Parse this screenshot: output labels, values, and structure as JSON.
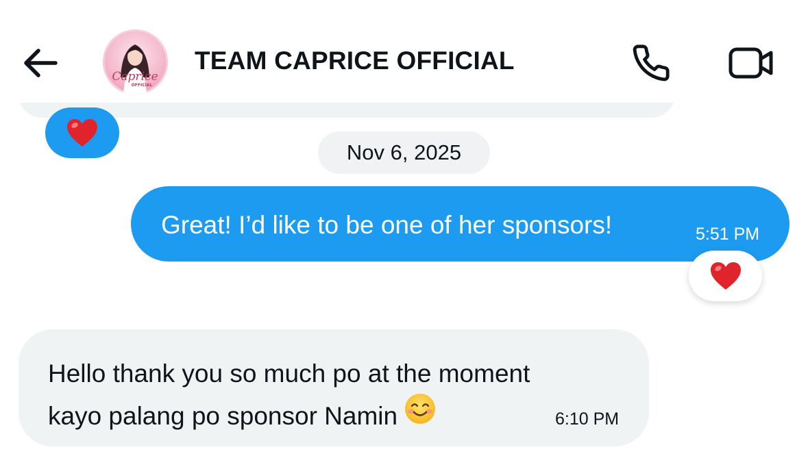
{
  "header": {
    "title": "TEAM CAPRICE OFFICIAL",
    "back_icon": "arrow-left-icon",
    "call_icon": "phone-icon",
    "video_icon": "video-camera-icon",
    "avatar_text": "Caprice",
    "avatar_subtext": "OFFICIAL"
  },
  "colors": {
    "accent": "#1d9bf0",
    "bubble_received": "#eff3f4",
    "text": "#0f1419",
    "heart": "#e0242c"
  },
  "conversation": {
    "date_separator": "Nov 6, 2025",
    "messages": [
      {
        "direction": "sent",
        "text": "Great! I’d like to be one of her sponsors!",
        "time": "5:51 PM",
        "reaction": "heart-emoji"
      },
      {
        "direction": "received",
        "line1": "Hello thank you so much po at the moment",
        "line2": "kayo palang po sponsor Namin",
        "emoji": "smiling-face-emoji",
        "time": "6:10 PM"
      }
    ],
    "previous_message_reaction": "heart-emoji"
  }
}
